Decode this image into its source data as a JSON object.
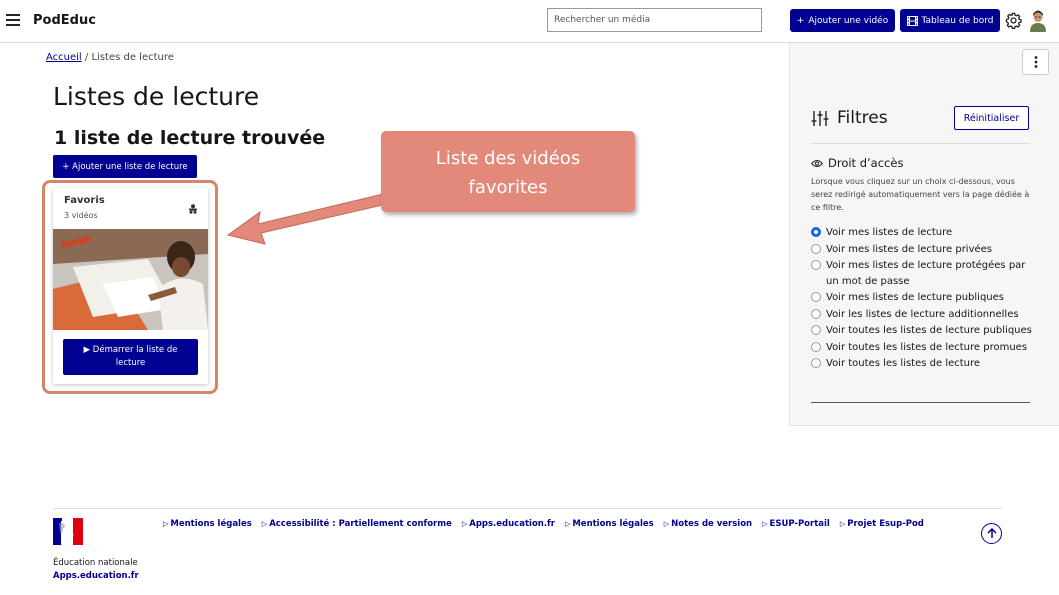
{
  "header": {
    "brand": "PodEduc",
    "search_placeholder": "Rechercher un média",
    "add_video_label": "Ajouter une vidéo",
    "dashboard_label": "Tableau de bord"
  },
  "breadcrumb": {
    "home": "Accueil",
    "separator": "/",
    "current": "Listes de lecture"
  },
  "main": {
    "title": "Listes de lecture",
    "count_title": "1 liste de lecture trouvée",
    "add_playlist_label": "+ Ajouter une liste de lecture",
    "playlists": [
      {
        "title": "Favoris",
        "subtitle": "3 vidéos",
        "start_label": "Démarrer la liste de lecture"
      }
    ]
  },
  "callout": {
    "line1": "Liste des vidéos",
    "line2": "favorites",
    "color": "#e2897a"
  },
  "filters": {
    "title": "Filtres",
    "reset_label": "Réinitialiser",
    "access_title": "Droit d’accès",
    "access_desc": "Lorsque vous cliquez sur un choix ci-dessous, vous serez redirigé automatiquement vers la page dédiée à ce filtre.",
    "options": [
      "Voir mes listes de lecture",
      "Voir mes listes de lecture privées",
      "Voir mes listes de lecture protégées par un mot de passe",
      "Voir mes listes de lecture publiques",
      "Voir les listes de lecture additionnelles",
      "Voir toutes les listes de lecture publiques",
      "Voir toutes les listes de lecture promues",
      "Voir toutes les listes de lecture"
    ],
    "selected_index": 0
  },
  "footer": {
    "org_name": "Éducation nationale",
    "org_link": "Apps.education.fr",
    "links": [
      "Mentions légales",
      "Accessibilité : Partiellement conforme",
      "Apps.education.fr",
      "Mentions légales",
      "Notes de version",
      "ESUP-Portail",
      "Projet Esup-Pod"
    ]
  },
  "colors": {
    "primary": "#000091",
    "highlight": "#d9826c",
    "radio_selected": "#0b6bd9"
  }
}
